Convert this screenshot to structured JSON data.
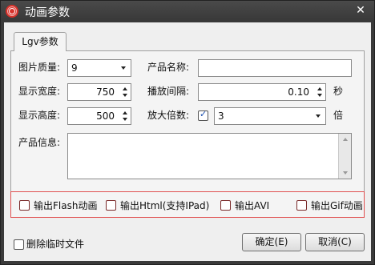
{
  "window": {
    "title": "动画参数",
    "close_glyph": "✕"
  },
  "tab": {
    "label": "Lgv参数"
  },
  "form": {
    "quality_label": "图片质量:",
    "quality_value": "9",
    "product_name_label": "产品名称:",
    "product_name_value": "",
    "width_label": "显示宽度:",
    "width_value": "750",
    "interval_label": "播放间隔:",
    "interval_value": "0.10",
    "interval_unit": "秒",
    "height_label": "显示高度:",
    "height_value": "500",
    "zoom_label": "放大倍数:",
    "zoom_checked": true,
    "zoom_value": "3",
    "zoom_unit": "倍",
    "info_label": "产品信息:",
    "info_value": ""
  },
  "outputs": [
    {
      "label": "输出Flash动画",
      "checked": false
    },
    {
      "label": "输出Html(支持IPad)",
      "checked": false
    },
    {
      "label": "输出AVI",
      "checked": false
    },
    {
      "label": "输出Gif动画",
      "checked": false
    }
  ],
  "footer": {
    "delete_temp_label": "删除临时文件",
    "delete_temp_checked": false,
    "ok_label": "确定(E)",
    "cancel_label": "取消(C)"
  },
  "colors": {
    "accent_red": "#e05050",
    "title_bg": "#3a3a3a",
    "app_icon": "#d8312a"
  }
}
